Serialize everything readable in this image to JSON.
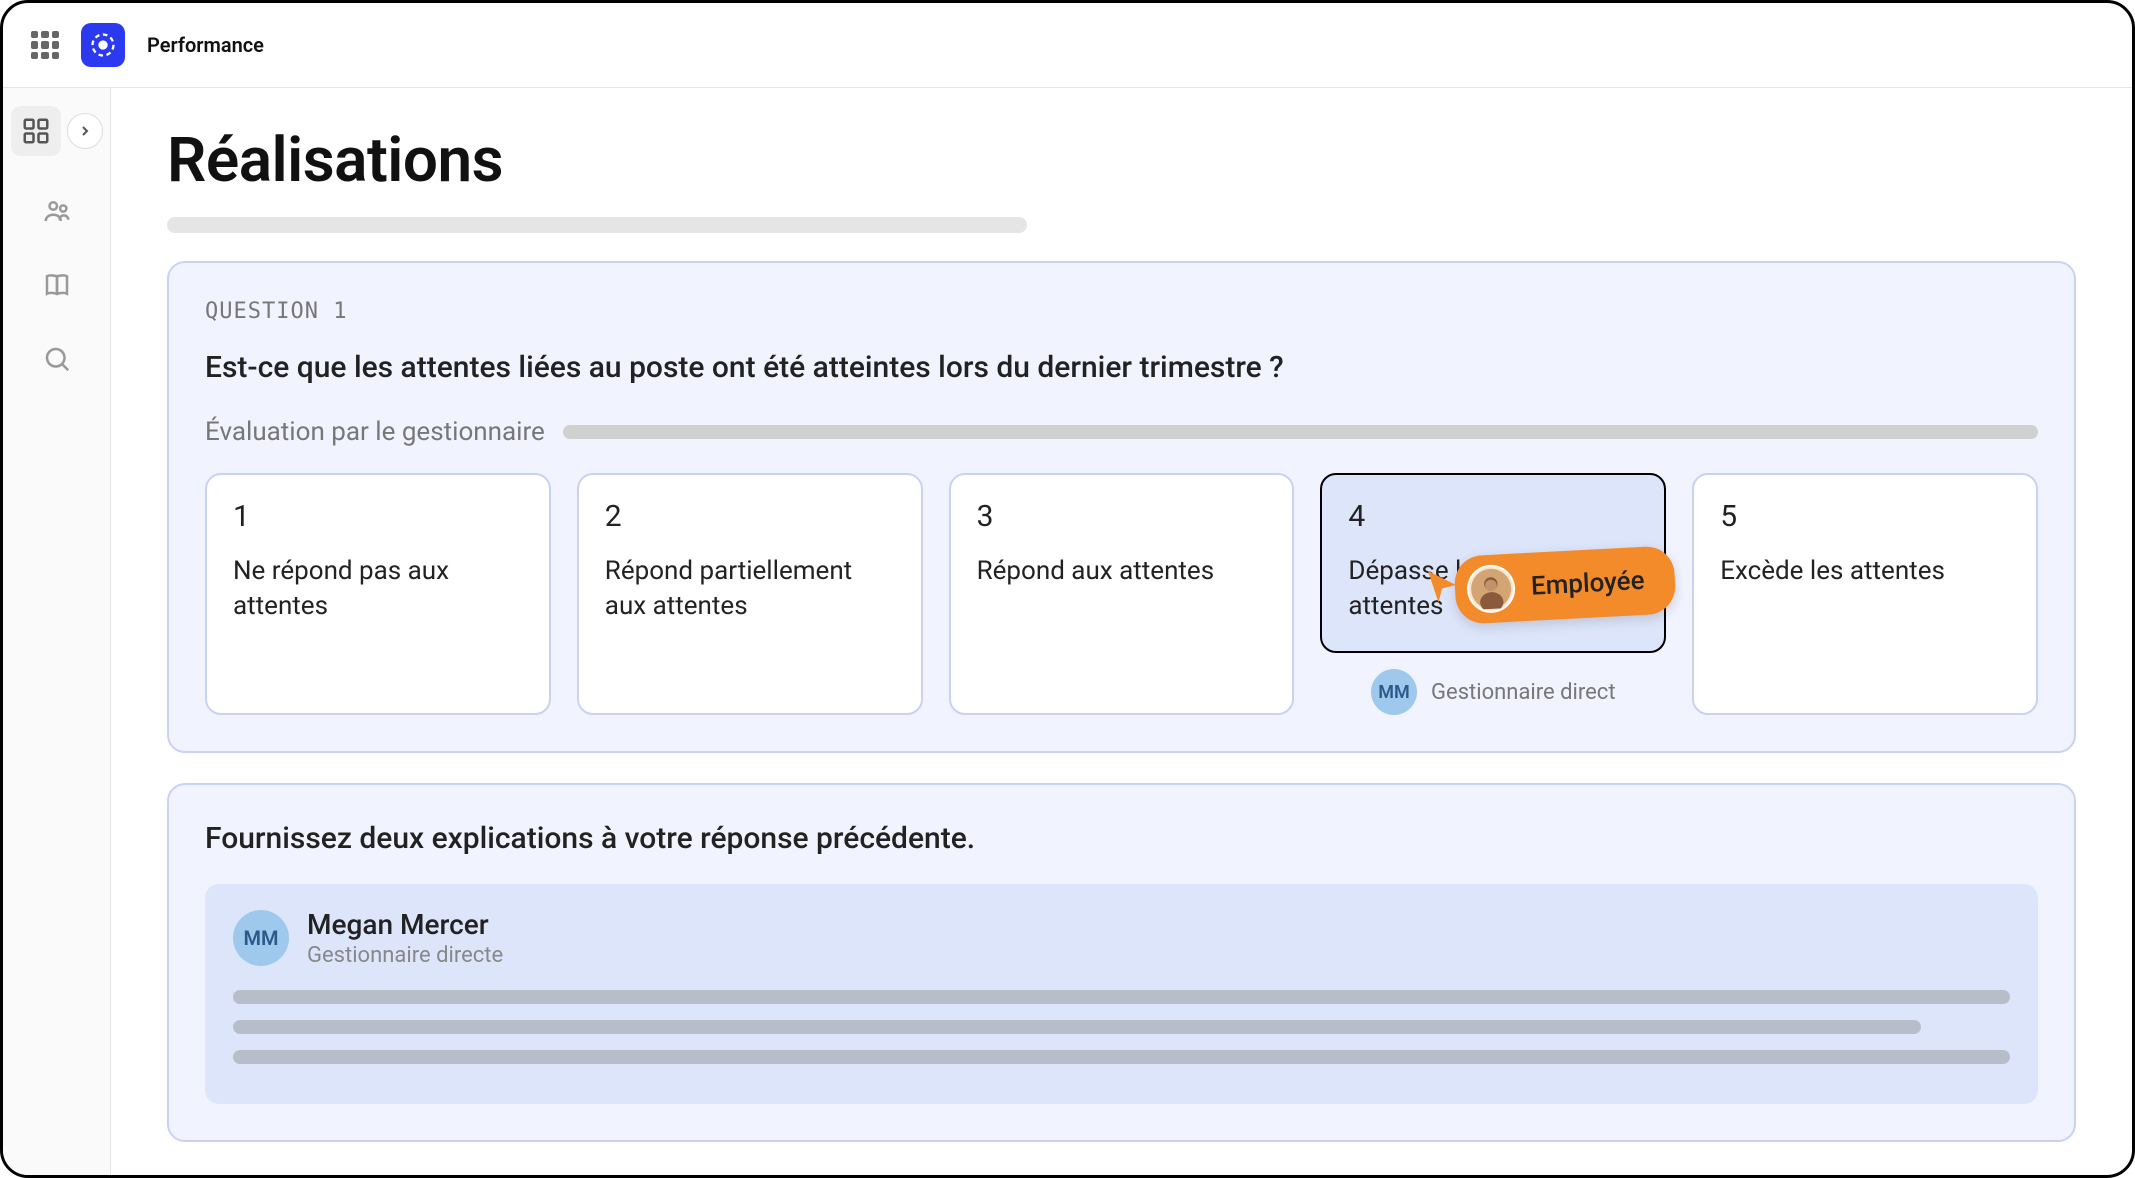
{
  "topbar": {
    "app_name": "Performance"
  },
  "page": {
    "title": "Réalisations"
  },
  "question_card": {
    "question_label": "QUESTION 1",
    "question_text": "Est-ce que les attentes liées au poste ont été atteintes lors du dernier trimestre ?",
    "eval_label": "Évaluation par le gestionnaire",
    "options": [
      {
        "num": "1",
        "text": "Ne répond pas aux attentes"
      },
      {
        "num": "2",
        "text": "Répond partiellement aux attentes"
      },
      {
        "num": "3",
        "text": "Répond aux attentes"
      },
      {
        "num": "4",
        "text": "Dépasse légèrement les attentes"
      },
      {
        "num": "5",
        "text": "Excède les attentes"
      }
    ],
    "selected_index": 3,
    "manager_tag": {
      "initials": "MM",
      "label": "Gestionnaire direct"
    },
    "employee_cursor": {
      "label": "Employée"
    }
  },
  "explanation_card": {
    "prompt": "Fournissez deux explications à votre réponse précédente.",
    "responder": {
      "initials": "MM",
      "name": "Megan Mercer",
      "role": "Gestionnaire directe"
    }
  },
  "colors": {
    "accent": "#2b3af0",
    "card_bg": "#f1f3fe",
    "card_border": "#c9d1f5",
    "selected_bg": "#dde5fb",
    "orange": "#f38b2a"
  }
}
